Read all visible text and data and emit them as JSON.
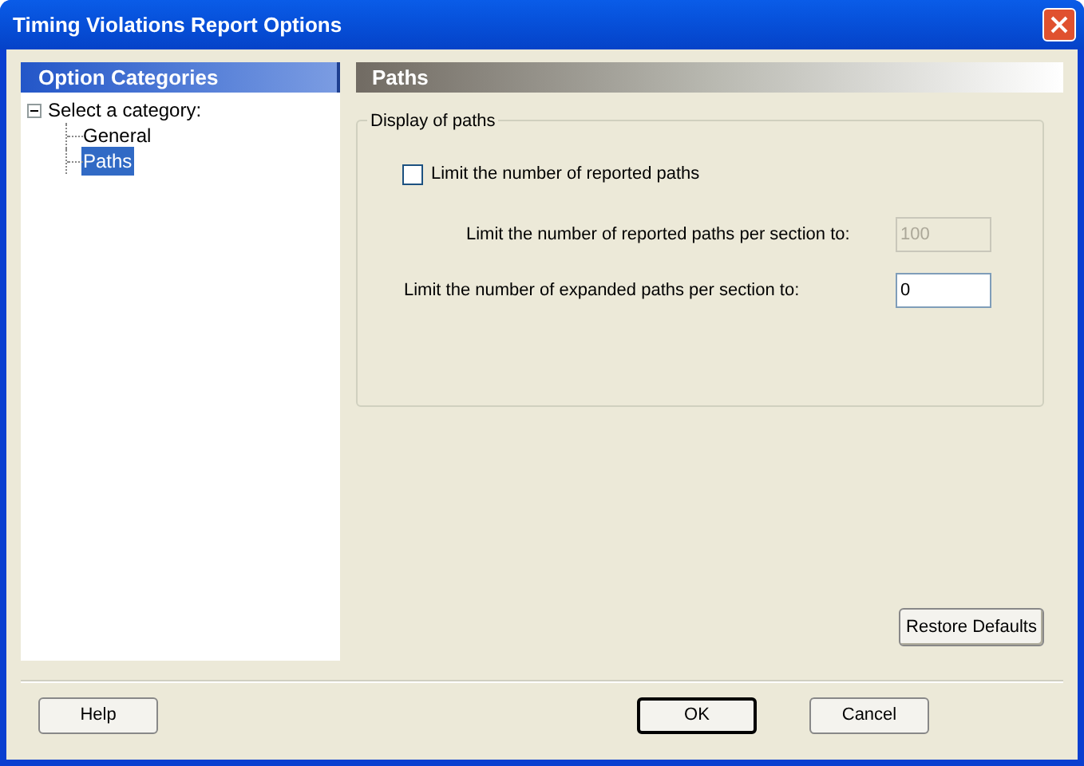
{
  "window": {
    "title": "Timing Violations Report Options"
  },
  "categories_panel": {
    "title": "Option Categories",
    "tree": [
      {
        "label": "Select a category:",
        "expanded": true,
        "selected": false,
        "children": [
          {
            "label": "General",
            "selected": false
          },
          {
            "label": "Paths",
            "selected": true
          }
        ]
      }
    ]
  },
  "page": {
    "title": "Paths",
    "group": {
      "title": "Display of paths",
      "fields": [
        {
          "kind": "checkbox",
          "label": "Limit the number of reported paths",
          "checked": false
        },
        {
          "kind": "number",
          "label": "Limit the number of reported paths per section to:",
          "value": "100",
          "disabled": true
        },
        {
          "kind": "number",
          "label": "Limit the number of expanded paths per section to:",
          "value": "0",
          "disabled": false
        }
      ]
    },
    "restore_button": "Restore Defaults"
  },
  "buttons": [
    {
      "label": "Help",
      "default": false
    },
    {
      "label": "OK",
      "default": true
    },
    {
      "label": "Cancel",
      "default": false
    }
  ]
}
